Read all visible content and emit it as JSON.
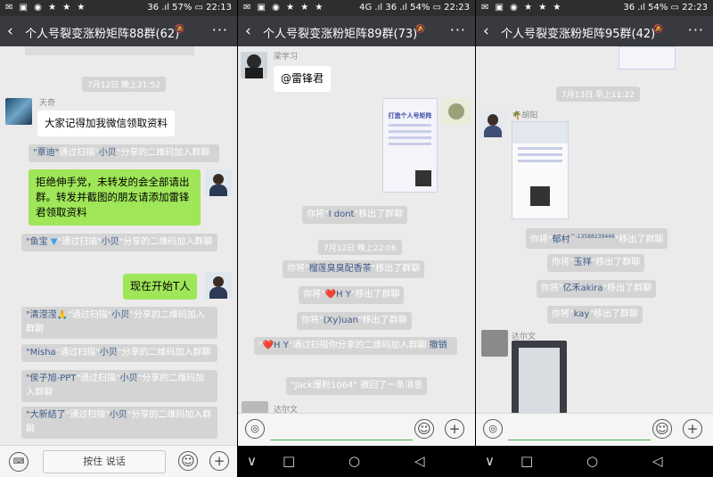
{
  "panels": [
    {
      "status": {
        "left_icons": "✉ ▣ ◉ ★ ★ ★",
        "right": "36 .ıl 57% ▭ 22:13"
      },
      "title": "个人号裂变涨粉矩阵88群(62)",
      "time1": "7月12日 晚上21:52",
      "sender1": "天奇",
      "msg1": "大家记得加我微信领取资料",
      "sys1": {
        "a": "\"覃迪\"",
        "b": "通过扫描\"",
        "c": "小贝",
        "d": "\"分享的二维码加入群聊"
      },
      "msg2": "拒绝伸手党，未转发的会全部请出群。转发并截图的朋友请添加雷锋君领取资料",
      "sys2": {
        "a": "\"鱼宝",
        "b": "\"通过扫描\"",
        "c": "小贝",
        "d": "\"分享的二维码加入群聊"
      },
      "msg3": "现在开始T人",
      "sys3": {
        "a": "\"清滢滢",
        "b": "\"通过扫描\"",
        "c": "小贝",
        "d": "\"分享的二维码加入群聊"
      },
      "sys4": {
        "a": "\"Misha",
        "b": "\"通过扫描\"",
        "c": "小贝",
        "d": "\"分享的二维码加入群聊"
      },
      "sys5": {
        "a": "\"侯子旭-PPT",
        "b": "\"通过扫描\"",
        "c": "小贝",
        "d": "\"分享的二维码加入群聊"
      },
      "sys6": {
        "a": "\"大新结了",
        "b": "\"通过扫描\"",
        "c": "小贝",
        "d": "\"分享的二维码加入群聊"
      },
      "hold_to_talk": "按住 说话"
    },
    {
      "status": {
        "left_icons": "✉ ▣ ◉ ★ ★ ★",
        "right": "4G .ıl 36 .ıl 54% ▭ 22:23"
      },
      "title": "个人号裂变涨粉矩阵89群(73)",
      "sender1": "梁学习",
      "msg1": "@雷锋君",
      "poster_title": "打造个人号矩阵",
      "sys1": {
        "a": "你将\"",
        "b": "I dont",
        "c": "\"移出了群聊"
      },
      "time1": "7月12日 晚上22:06",
      "sys2": {
        "a": "你将\"",
        "b": "榴莲臭臭配香茶",
        "c": "\"移出了群聊"
      },
      "sys3": {
        "a": "你将\"",
        "b": "❤️H Y",
        "c": "\"移出了群聊"
      },
      "sys4": {
        "a": "你将\"",
        "b": "(Xy)uan",
        "c": "\"移出了群聊"
      },
      "sys5": {
        "a": "\"",
        "b": "❤️H Y",
        "c": "\"通过扫描你分享的二维码加入群聊",
        "d": "撤销"
      },
      "sys6": "\"Jack爆粉1064\" 撤回了一条消息",
      "sender2": "达尔文"
    },
    {
      "status": {
        "left_icons": "✉ ▣ ◉ ★ ★ ★",
        "right": "36 .ıl 54% ▭ 22:23"
      },
      "title": "个人号裂变涨粉矩阵95群(42)",
      "time1": "7月13日 早上11:22",
      "sender1": "胡阳",
      "sys1": {
        "a": "你将\"",
        "b": "郁村",
        "sup": "™-13588239446",
        "c": "\"移出了群聊"
      },
      "sys2": {
        "a": "你将\"",
        "b": "玉祥",
        "c": "\"移出了群聊"
      },
      "sys3": {
        "a": "你将\"",
        "b": "亿禾akira",
        "c": "\"移出了群聊"
      },
      "sys4": {
        "a": "你将\"",
        "b": "kay",
        "c": "\"移出了群聊"
      },
      "sender2": "达尔文"
    }
  ],
  "icons": {
    "back": "back-chevron-icon",
    "more": "more-dots-icon",
    "bell": "mute-bell-icon",
    "voice": "voice-icon",
    "emoji": "emoji-icon",
    "plus": "plus-icon",
    "keyboard": "keyboard-icon"
  },
  "nav": {
    "back": "◁",
    "home": "○",
    "recent": "□",
    "down": "∨"
  },
  "colors": {
    "green_bubble": "#9fe658",
    "titlebar": "#393a3f",
    "chat_bg": "#ebebeb",
    "name_link": "#3c5b8a"
  }
}
